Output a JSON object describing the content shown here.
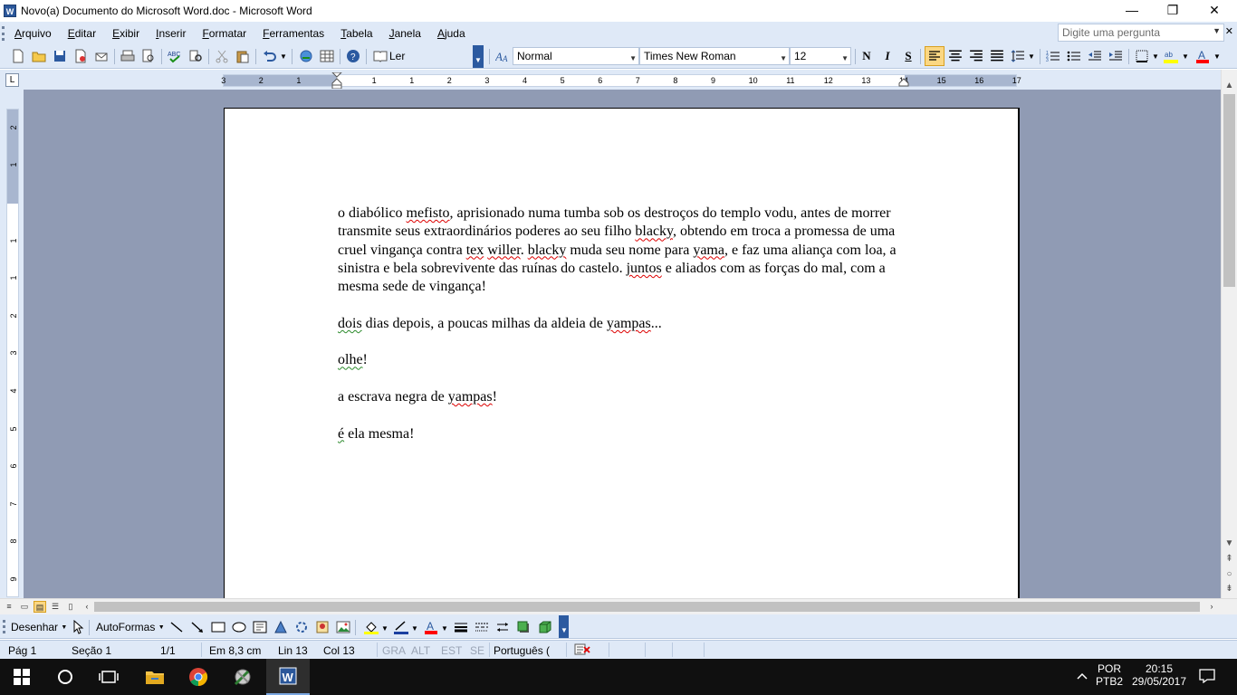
{
  "window": {
    "title": "Novo(a) Documento do Microsoft Word.doc - Microsoft Word",
    "minimize_glyph": "—",
    "restore_glyph": "❐",
    "close_glyph": "✕"
  },
  "menu": {
    "items": [
      {
        "label": "Arquivo"
      },
      {
        "label": "Editar"
      },
      {
        "label": "Exibir"
      },
      {
        "label": "Inserir"
      },
      {
        "label": "Formatar"
      },
      {
        "label": "Ferramentas"
      },
      {
        "label": "Tabela"
      },
      {
        "label": "Janela"
      },
      {
        "label": "Ajuda"
      }
    ],
    "ask_placeholder": "Digite uma pergunta",
    "close_doc_glyph": "✕"
  },
  "toolbar": {
    "read_label": "Ler",
    "style_value": "Normal",
    "font_value": "Times New Roman",
    "size_value": "12",
    "bold_label": "N",
    "italic_label": "I",
    "underline_label": "S",
    "highlight_color": "#ffff00",
    "font_color": "#ff0000"
  },
  "ruler": {
    "h_numbers": [
      "3",
      "2",
      "1",
      "1",
      "1",
      "2",
      "3",
      "4",
      "5",
      "6",
      "7",
      "8",
      "9",
      "10",
      "11",
      "12",
      "13",
      "14",
      "15",
      "16",
      "17"
    ],
    "v_numbers": [
      "2",
      "1",
      "1",
      "1",
      "2",
      "3",
      "4",
      "5",
      "6",
      "7",
      "8",
      "9",
      "10"
    ],
    "tab_selector": "L"
  },
  "document": {
    "paragraphs": [
      "o diabólico mefisto, aprisionado numa tumba sob os destroços do templo vodu, antes de morrer transmite seus extraordinários poderes ao seu filho blacky, obtendo em troca a promessa de uma cruel vingança contra tex willer. blacky muda seu nome para yama, e faz uma aliança com loa, a sinistra e bela sobrevivente das ruínas do castelo. juntos e aliados com as forças do mal, com a mesma sede de vingança!",
      "dois dias depois, a poucas milhas da aldeia de yampas...",
      "olhe!",
      "a escrava negra de yampas!",
      "é ela mesma!"
    ]
  },
  "drawing": {
    "draw_label": "Desenhar",
    "autoshapes_label": "AutoFormas"
  },
  "status": {
    "page": "Pág 1",
    "section": "Seção 1",
    "pages": "1/1",
    "at": "Em 8,3 cm",
    "line": "Lin 13",
    "col": "Col 13",
    "rec": "GRA",
    "trk": "ALT",
    "ext": "EST",
    "ovr": "SE",
    "language": "Português ("
  },
  "taskbar": {
    "lang_top": "POR",
    "lang_bottom": "PTB2",
    "time": "20:15",
    "date": "29/05/2017"
  }
}
